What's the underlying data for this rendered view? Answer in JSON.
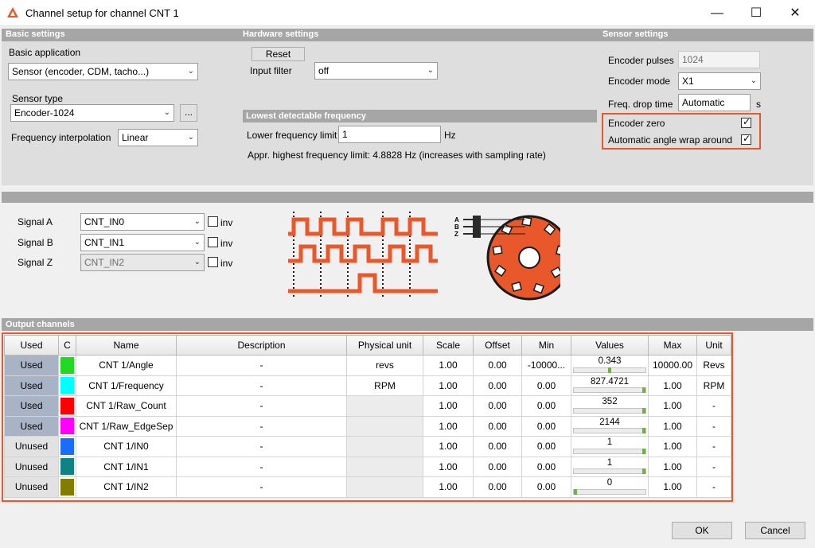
{
  "window": {
    "title": "Channel setup for channel CNT 1",
    "minimize": "—",
    "maximize": "☐",
    "close": "✕"
  },
  "basic": {
    "header": "Basic settings",
    "application_label": "Basic application",
    "application_value": "Sensor (encoder, CDM, tacho...)",
    "sensor_type_label": "Sensor type",
    "sensor_type_value": "Encoder-1024",
    "browse_label": "...",
    "freq_interp_label": "Frequency interpolation",
    "freq_interp_value": "Linear"
  },
  "hardware": {
    "header": "Hardware settings",
    "reset_label": "Reset",
    "input_filter_label": "Input filter",
    "input_filter_value": "off",
    "lowest_header": "Lowest detectable frequency",
    "lower_limit_label": "Lower frequency limit",
    "lower_limit_value": "1",
    "lower_limit_unit": "Hz",
    "highest_text": "Appr. highest frequency limit: 4.8828 Hz (increases with sampling rate)"
  },
  "sensor": {
    "header": "Sensor settings",
    "pulses_label": "Encoder pulses",
    "pulses_value": "1024",
    "mode_label": "Encoder mode",
    "mode_value": "X1",
    "drop_label": "Freq. drop time",
    "drop_value": "Automatic",
    "drop_unit": "s",
    "zero_label": "Encoder zero",
    "zero_checked": true,
    "wrap_label": "Automatic angle wrap around",
    "wrap_checked": true
  },
  "signals": [
    {
      "label": "Signal A",
      "value": "CNT_IN0",
      "inv": "inv",
      "disabled": false
    },
    {
      "label": "Signal B",
      "value": "CNT_IN1",
      "inv": "inv",
      "disabled": false
    },
    {
      "label": "Signal Z",
      "value": "CNT_IN2",
      "inv": "inv",
      "disabled": true
    }
  ],
  "diagram": {
    "letters": [
      "A",
      "B",
      "Z"
    ],
    "accent": "#e8582a"
  },
  "output": {
    "header": "Output channels",
    "columns": [
      "Used",
      "C",
      "Name",
      "Description",
      "Physical unit",
      "Scale",
      "Offset",
      "Min",
      "Values",
      "Max",
      "Unit"
    ],
    "rows": [
      {
        "used": "Used",
        "color": "#22d822",
        "name": "CNT 1/Angle",
        "description": "-",
        "phys": "revs",
        "scale": "1.00",
        "offset": "0.00",
        "min": "-10000...",
        "value": "0.343",
        "level": 0.5,
        "max": "10000.00",
        "unit": "Revs"
      },
      {
        "used": "Used",
        "color": "#00ffff",
        "name": "CNT 1/Frequency",
        "description": "-",
        "phys": "RPM",
        "scale": "1.00",
        "offset": "0.00",
        "min": "0.00",
        "value": "827.4721",
        "level": 1.0,
        "max": "1.00",
        "unit": "RPM"
      },
      {
        "used": "Used",
        "color": "#ff0000",
        "name": "CNT 1/Raw_Count",
        "description": "-",
        "phys": "",
        "scale": "1.00",
        "offset": "0.00",
        "min": "0.00",
        "value": "352",
        "level": 1.0,
        "max": "1.00",
        "unit": "-"
      },
      {
        "used": "Used",
        "color": "#ff00ff",
        "name": "CNT 1/Raw_EdgeSep",
        "description": "-",
        "phys": "",
        "scale": "1.00",
        "offset": "0.00",
        "min": "0.00",
        "value": "2144",
        "level": 1.0,
        "max": "1.00",
        "unit": "-"
      },
      {
        "used": "Unused",
        "color": "#1a6cff",
        "name": "CNT 1/IN0",
        "description": "-",
        "phys": "",
        "scale": "1.00",
        "offset": "0.00",
        "min": "0.00",
        "value": "1",
        "level": 1.0,
        "max": "1.00",
        "unit": "-"
      },
      {
        "used": "Unused",
        "color": "#0f8282",
        "name": "CNT 1/IN1",
        "description": "-",
        "phys": "",
        "scale": "1.00",
        "offset": "0.00",
        "min": "0.00",
        "value": "1",
        "level": 1.0,
        "max": "1.00",
        "unit": "-"
      },
      {
        "used": "Unused",
        "color": "#807d00",
        "name": "CNT 1/IN2",
        "description": "-",
        "phys": "",
        "scale": "1.00",
        "offset": "0.00",
        "min": "0.00",
        "value": "0",
        "level": 0.0,
        "max": "1.00",
        "unit": "-"
      }
    ]
  },
  "footer": {
    "ok": "OK",
    "cancel": "Cancel"
  }
}
